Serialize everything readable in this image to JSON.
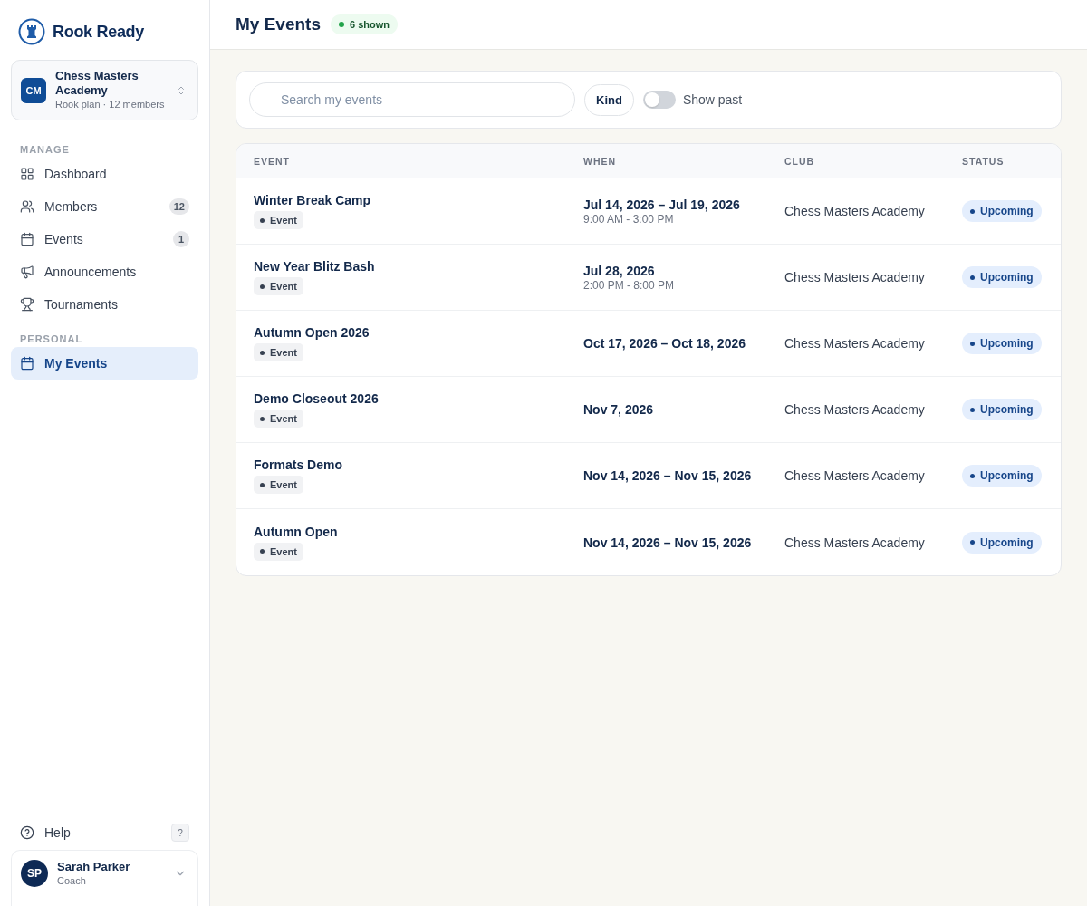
{
  "brand": {
    "name": "Rook Ready"
  },
  "workspace": {
    "initials": "CM",
    "name": "Chess Masters Academy",
    "meta": "Rook plan · 12 members"
  },
  "sidebar": {
    "sections": [
      {
        "heading": "MANAGE",
        "items": [
          {
            "label": "Dashboard",
            "selected": false
          },
          {
            "label": "Members",
            "badge": "12",
            "selected": false
          },
          {
            "label": "Events",
            "badge": "1",
            "selected": false
          },
          {
            "label": "Announcements",
            "selected": false
          },
          {
            "label": "Tournaments",
            "selected": false
          }
        ]
      },
      {
        "heading": "PERSONAL",
        "items": [
          {
            "label": "My Events",
            "selected": true
          }
        ]
      }
    ]
  },
  "help": {
    "label": "Help",
    "shortcut": "?"
  },
  "user": {
    "initials": "SP",
    "name": "Sarah Parker",
    "role": "Coach"
  },
  "page": {
    "title": "My Events",
    "count": "6 shown"
  },
  "filters": {
    "search": {
      "placeholder": "Search my events"
    },
    "kind_button": "Kind",
    "show_past": {
      "label": "Show past",
      "on": false
    }
  },
  "table": {
    "columns": [
      "EVENT",
      "WHEN",
      "CLUB",
      "STATUS"
    ],
    "rows": [
      {
        "event": "Winter Break Camp",
        "tag": "Event",
        "when": "Jul 14, 2026 – Jul 19, 2026",
        "time": "9:00 AM - 3:00 PM",
        "club": "Chess Masters Academy",
        "status": "Upcoming"
      },
      {
        "event": "New Year Blitz Bash",
        "tag": "Event",
        "when": "Jul 28, 2026",
        "time": "2:00 PM - 8:00 PM",
        "club": "Chess Masters Academy",
        "status": "Upcoming"
      },
      {
        "event": "Autumn Open 2026",
        "tag": "Event",
        "when": "Oct 17, 2026 – Oct 18, 2026",
        "club": "Chess Masters Academy",
        "status": "Upcoming"
      },
      {
        "event": "Demo Closeout 2026",
        "tag": "Event",
        "when": "Nov 7, 2026",
        "club": "Chess Masters Academy",
        "status": "Upcoming"
      },
      {
        "event": "Formats Demo",
        "tag": "Event",
        "when": "Nov 14, 2026 – Nov 15, 2026",
        "club": "Chess Masters Academy",
        "status": "Upcoming"
      },
      {
        "event": "Autumn Open",
        "tag": "Event",
        "when": "Nov 14, 2026 – Nov 15, 2026",
        "club": "Chess Masters Academy",
        "status": "Upcoming"
      }
    ]
  }
}
